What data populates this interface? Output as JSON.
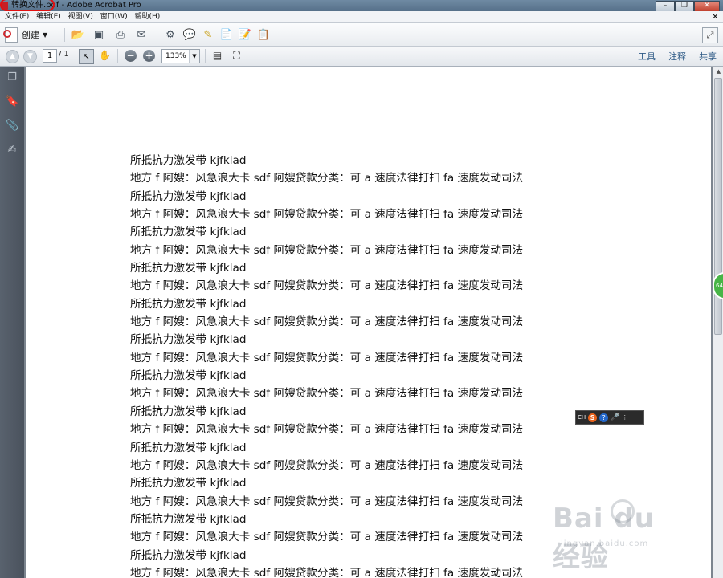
{
  "window": {
    "title": "转换文件.pdf - Adobe Acrobat Pro",
    "controls": {
      "minimize": "–",
      "restore": "❐",
      "close": "✕"
    }
  },
  "menu": {
    "items": [
      "文件(F)",
      "编辑(E)",
      "视图(V)",
      "窗口(W)",
      "帮助(H)"
    ],
    "close": "×"
  },
  "toolbar": {
    "create_label": "创建"
  },
  "nav": {
    "page_current": "1",
    "page_total": "/ 1",
    "zoom": "133%"
  },
  "right_tabs": {
    "tools": "工具",
    "comment": "注释",
    "share": "共享"
  },
  "document": {
    "lines": [
      "所抵抗力激发带 kjfklad",
      "地方 f 阿嫂：风急浪大卡 sdf 阿嫂贷款分类：可 a 速度法律打扫 fa 速度发动司法",
      "所抵抗力激发带 kjfklad",
      "地方 f 阿嫂：风急浪大卡 sdf 阿嫂贷款分类：可 a 速度法律打扫 fa 速度发动司法",
      "所抵抗力激发带 kjfklad",
      "地方 f 阿嫂：风急浪大卡 sdf 阿嫂贷款分类：可 a 速度法律打扫 fa 速度发动司法",
      "所抵抗力激发带 kjfklad",
      "地方 f 阿嫂：风急浪大卡 sdf 阿嫂贷款分类：可 a 速度法律打扫 fa 速度发动司法",
      "所抵抗力激发带 kjfklad",
      "地方 f 阿嫂：风急浪大卡 sdf 阿嫂贷款分类：可 a 速度法律打扫 fa 速度发动司法",
      "所抵抗力激发带 kjfklad",
      "地方 f 阿嫂：风急浪大卡 sdf 阿嫂贷款分类：可 a 速度法律打扫 fa 速度发动司法",
      "所抵抗力激发带 kjfklad",
      "地方 f 阿嫂：风急浪大卡 sdf 阿嫂贷款分类：可 a 速度法律打扫 fa 速度发动司法",
      "所抵抗力激发带 kjfklad",
      "地方 f 阿嫂：风急浪大卡 sdf 阿嫂贷款分类：可 a 速度法律打扫 fa 速度发动司法",
      "所抵抗力激发带 kjfklad",
      "地方 f 阿嫂：风急浪大卡 sdf 阿嫂贷款分类：可 a 速度法律打扫 fa 速度发动司法",
      "所抵抗力激发带 kjfklad",
      "地方 f 阿嫂：风急浪大卡 sdf 阿嫂贷款分类：可 a 速度法律打扫 fa 速度发动司法",
      "所抵抗力激发带 kjfklad",
      "地方 f 阿嫂：风急浪大卡 sdf 阿嫂贷款分类：可 a 速度法律打扫 fa 速度发动司法",
      "所抵抗力激发带 kjfklad",
      "地方 f 阿嫂：风急浪大卡 sdf 阿嫂贷款分类：可 a 速度法律打扫 fa 速度发动司法"
    ]
  },
  "ime_bar": {
    "lang": "CH",
    "s_icon": "S",
    "help_icon": "?"
  },
  "side_bubble": "64",
  "watermark": {
    "main": "Bai du 经验",
    "sub": "jingyan.baidu.com"
  },
  "colors": {
    "annotation_circle": "#e31010",
    "tab_text": "#2e5a86"
  }
}
